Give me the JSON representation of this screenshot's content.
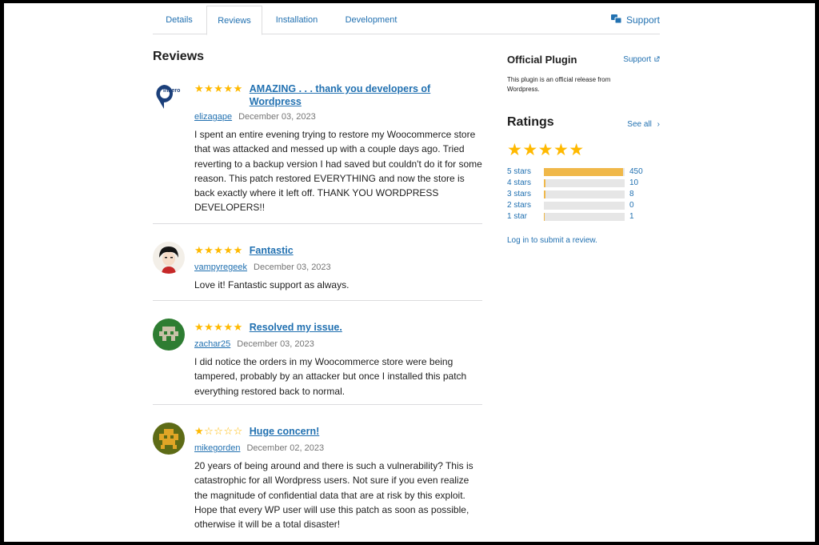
{
  "tabs": {
    "items": [
      {
        "label": "Details"
      },
      {
        "label": "Reviews"
      },
      {
        "label": "Installation"
      },
      {
        "label": "Development"
      }
    ],
    "support_label": "Support"
  },
  "reviews_heading": "Reviews",
  "reviews": [
    {
      "rating": 5,
      "title_line1": "AMAZING . . . thank you developers of",
      "title_line2": "Wordpress",
      "author": "elizagape",
      "date": "December 03, 2023",
      "text": "I spent an entire evening trying to restore my Woocommerce store that was attacked and messed up with a couple days ago. Tried reverting to a backup version I had saved but couldn't do it for some reason. This patch restored EVERYTHING and now the store is back exactly where it left off. THANK YOU WORDPRESS DEVELOPERS!!",
      "avatar_text": "Inhero"
    },
    {
      "rating": 5,
      "title_line1": "Fantastic",
      "author": "vampyregeek",
      "date": "December 03, 2023",
      "text": "Love it! Fantastic support as always."
    },
    {
      "rating": 5,
      "title_line1": "Resolved my issue.",
      "author": "zachar25",
      "date": "December 03, 2023",
      "text": "I did notice the orders in my Woocommerce store were being tampered, probably by an attacker but once I installed this patch everything restored back to normal."
    },
    {
      "rating": 1,
      "title_line1": "Huge concern!",
      "author": "mikegorden",
      "date": "December 02, 2023",
      "text": "20 years of being around and there is such a vulnerability? This is catastrophic for all Wordpress users. Not sure if you even realize the magnitude of confidential data that are at risk by this exploit. Hope that every WP user will use this patch as soon as possible, otherwise it will be a total disaster!"
    }
  ],
  "sidebar": {
    "official_title": "Official Plugin",
    "support_link": "Support",
    "official_text": "This plugin is an official release from Wordpress.",
    "ratings_title": "Ratings",
    "see_all": "See all",
    "overall_stars": 5,
    "breakdown": [
      {
        "label": "5 stars",
        "count": "450",
        "fill": 0.98
      },
      {
        "label": "4 stars",
        "count": "10",
        "fill": 0.02
      },
      {
        "label": "3 stars",
        "count": "8",
        "fill": 0.018
      },
      {
        "label": "2 stars",
        "count": "0",
        "fill": 0
      },
      {
        "label": "1 star",
        "count": "1",
        "fill": 0.005
      }
    ],
    "login_link": "Log in to submit a review."
  },
  "colors": {
    "link": "#2271b1",
    "star": "#ffb900",
    "bar_fill": "#f0b849",
    "bar_track": "#e6e6e6"
  }
}
